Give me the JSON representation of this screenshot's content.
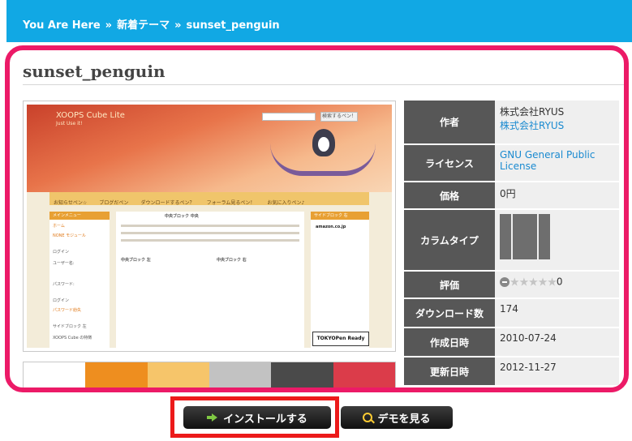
{
  "breadcrumb": {
    "items": [
      "You Are Here",
      "新着テーマ",
      "sunset_penguin"
    ],
    "separator": "»"
  },
  "theme": {
    "title": "sunset_penguin"
  },
  "screenshot": {
    "logo": "XOOPS Cube Lite",
    "subtitle": "Just Use it!",
    "search_button": "検索するペン！",
    "nav": [
      "お知らせペン☆",
      "ブログだペン",
      "ダウンロードするペン？",
      "フォーラム見るペン！",
      "お気に入りペン♪"
    ],
    "left_menu": [
      "メインメニュー",
      "ホーム",
      "NONE モジュール",
      "ログイン",
      "ユーザー名:",
      "パスワード:",
      "ログイン",
      "パスワード紛失",
      "サイドブロック 左",
      "XOOPS Cube の特徴"
    ],
    "center_title": "中央ブロック 中央",
    "center_left_title": "中央ブロック 左",
    "center_right_title": "中央ブロック 右",
    "right_title": "サイドブロック 右",
    "amazon": "amazon.co.jp",
    "badge": "TOKYOPen Ready"
  },
  "swatches": [
    "#ffffff",
    "#ee8e1f",
    "#f6c56a",
    "#c2c2c2",
    "#4a4a4a",
    "#db3c4a"
  ],
  "info": {
    "author_label": "作者",
    "author_name": "株式会社RYUS",
    "author_link": "株式会社RYUS",
    "license_label": "ライセンス",
    "license_value": "GNU General Public License",
    "price_label": "価格",
    "price_value": "0円",
    "column_label": "カラムタイプ",
    "rating_label": "評価",
    "rating_value": "0",
    "rating_stars": 0,
    "rating_max": 5,
    "downloads_label": "ダウンロード数",
    "downloads_value": "174",
    "created_label": "作成日時",
    "created_value": "2010-07-24",
    "updated_label": "更新日時",
    "updated_value": "2012-11-27"
  },
  "actions": {
    "install_label": "インストールする",
    "demo_label": "デモを見る"
  },
  "colors": {
    "topbar": "#11a8e4",
    "highlight": "#ec1a67",
    "install_frame": "#ec1a1a",
    "label_bg": "#575757",
    "link": "#1a8ad0"
  }
}
